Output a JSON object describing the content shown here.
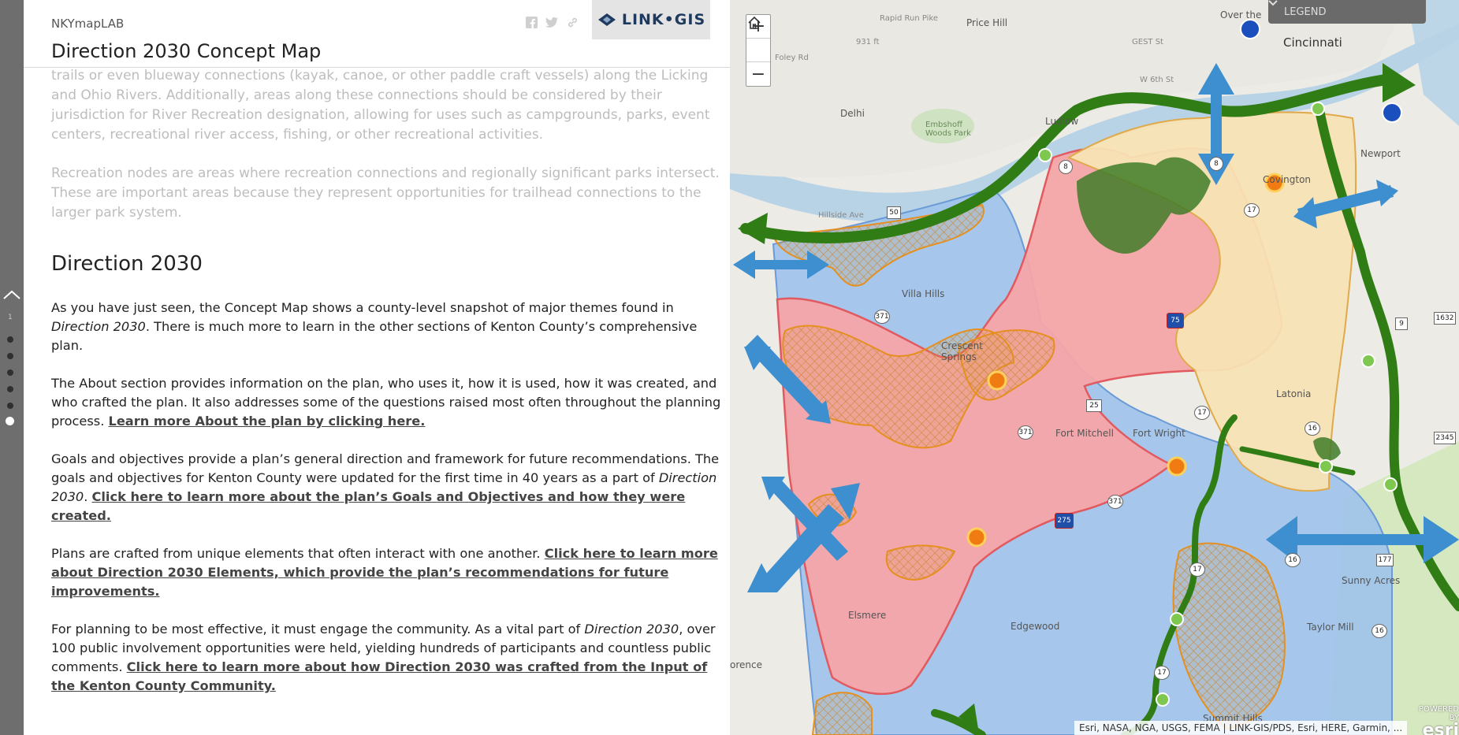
{
  "header": {
    "brand": "NKYmapLAB",
    "title": "Direction 2030 Concept Map",
    "logo_text": "LINK•GIS"
  },
  "story": {
    "faded_paragraphs": [
      "trails or even blueway connections (kayak, canoe, or other paddle craft vessels) along the Licking and Ohio Rivers. Additionally, areas along these connections should be considered by their jurisdiction for River Recreation designation, allowing for uses such as campgrounds, parks, event centers, recreational river access, fishing, or other recreational activities.",
      "Recreation nodes are areas where recreation connections and regionally significant parks intersect. These are important areas because they represent opportunities for trailhead connections to the larger park system."
    ],
    "section_heading": "Direction 2030",
    "p1_a": "As you have just seen, the Concept Map shows a county-level snapshot of major themes found in ",
    "p1_em": "Direction 2030",
    "p1_b": ". There is much more to learn in the other sections of Kenton County’s comprehensive plan.",
    "p2_text": "The About section provides information on the plan, who uses it, how it is used, how it was created, and who crafted the plan. It also addresses some of the questions raised most often throughout the planning process. ",
    "p2_link": "Learn more About the plan by clicking here.",
    "p3_a": "Goals and objectives provide a plan’s general direction and framework for future recommendations. The goals and objectives for Kenton County were updated for the first time in 40 years as a part of ",
    "p3_em": "Direction 2030",
    "p3_b": ". ",
    "p3_link": "Click here to learn more about the plan’s Goals and Objectives and how they were created.",
    "p4_text": "Plans are crafted from unique elements that often interact with one another. ",
    "p4_link": "Click here to learn more about Direction 2030 Elements, which provide the plan’s recommendations for future improvements.",
    "p5_a": "For planning to be most effective, it must engage the community. As a vital part of ",
    "p5_em": "Direction 2030",
    "p5_b": ", over 100 public involvement opportunities were held, yielding hundreds of participants and countless public comments. ",
    "p5_link": "Click here to learn more about how Direction 2030 was crafted from the Input of the Kenton County Community."
  },
  "nav": {
    "current_index": "1"
  },
  "map": {
    "zoom_in": "+",
    "zoom_out": "−",
    "legend_label": "LEGEND",
    "attribution": "Esri, NASA, NGA, USGS, FEMA | LINK-GIS/PDS, Esri, HERE, Garmin, ...",
    "esri_powered": "POWERED BY",
    "esri_logo": "esri",
    "labels": {
      "price_hill": "Price Hill",
      "cincinnati": "Cincinnati",
      "over_the": "Over the",
      "delhi": "Delhi",
      "embshoff": "Embshoff Woods Park",
      "ludlow": "Ludlow",
      "newport": "Newport",
      "covington": "Covington",
      "villa_hills": "Villa Hills",
      "crescent_springs": "Crescent Springs",
      "fort_mitchell": "Fort Mitchell",
      "fort_wright": "Fort Wright",
      "latonia": "Latonia",
      "elsmere": "Elsmere",
      "edgewood": "Edgewood",
      "sunny_acres": "Sunny Acres",
      "taylor_mill": "Taylor Mill",
      "summit_hills": "Summit Hills",
      "florence": "orence",
      "rapid_run": "Rapid Run Pike",
      "foley_rd": "Foley Rd",
      "hillside_ave": "Hillside Ave",
      "w6th": "W 6th St",
      "gest_st": "GEST St",
      "elev_931": "931 ft"
    },
    "shields": {
      "r371a": "371",
      "r371b": "371",
      "r371c": "371",
      "r8a": "8",
      "r8b": "8",
      "r17a": "17",
      "r17b": "17",
      "r17c": "17",
      "r17d": "17",
      "r16a": "16",
      "r16b": "16",
      "r16c": "16",
      "r25": "25",
      "r75": "75",
      "r275": "275",
      "r9": "9",
      "r177": "177",
      "r1632": "1632",
      "r2345": "2345",
      "r50": "50"
    },
    "colors": {
      "residential_blue": "#9fc3ec",
      "mixed_red": "#f4a5a8",
      "urban_yellow": "#f7e3b4",
      "green_corridor": "#2f7d14",
      "arrow_blue": "#3d8fd0",
      "hatch_orange": "#e58f1e"
    }
  }
}
